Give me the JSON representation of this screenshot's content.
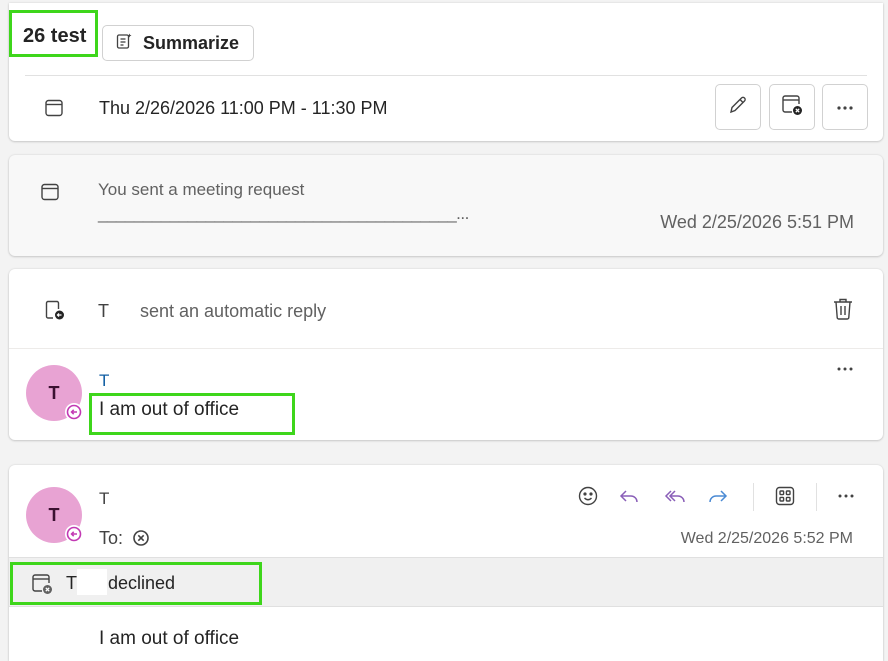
{
  "header": {
    "subject": "26 test",
    "summarize_label": "Summarize",
    "date_range": "Thu 2/26/2026 11:00 PM - 11:30 PM"
  },
  "meeting_request": {
    "text": "You sent a meeting request",
    "preview": "________________________________________...",
    "time": "Wed 2/25/2026 5:51 PM"
  },
  "auto_reply": {
    "sender": "T",
    "text": "sent an automatic reply",
    "avatar_initial": "T",
    "reply_sender": "T",
    "body": "I am out of office"
  },
  "message": {
    "avatar_initial": "T",
    "sender": "T",
    "to_label": "To:",
    "time": "Wed 2/25/2026 5:52 PM",
    "declined_sender": "T",
    "declined_text": "declined",
    "body": "I am out of office"
  },
  "colors": {
    "highlight": "#3ed61b",
    "avatar_bg": "#e8a3d3",
    "presence": "#c239b3",
    "action_blue": "#4a8ad4",
    "action_purple": "#8a5fb8"
  },
  "icons": [
    "summarize-icon",
    "calendar-icon",
    "edit-icon",
    "cancel-meeting-icon",
    "more-icon",
    "auto-reply-icon",
    "delete-icon",
    "emoji-icon",
    "reply-icon",
    "reply-all-icon",
    "forward-icon",
    "apps-icon",
    "blocked-icon",
    "presence-ooo-icon"
  ]
}
